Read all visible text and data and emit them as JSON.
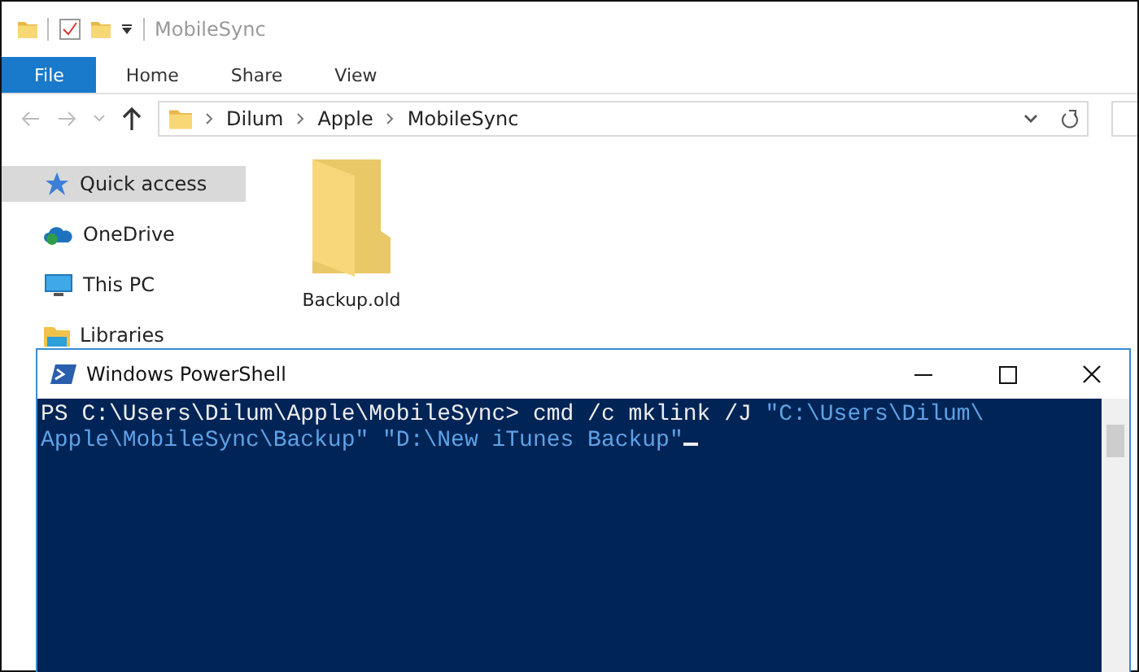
{
  "explorer": {
    "title": "MobileSync",
    "tabs": [
      {
        "label": "File",
        "selected": true
      },
      {
        "label": "Home",
        "selected": false
      },
      {
        "label": "Share",
        "selected": false
      },
      {
        "label": "View",
        "selected": false
      }
    ],
    "breadcrumbs": [
      "Dilum",
      "Apple",
      "MobileSync"
    ],
    "sidebar": [
      {
        "label": "Quick access",
        "kind": "star",
        "selected": true
      },
      {
        "label": "OneDrive",
        "kind": "cloud",
        "selected": false
      },
      {
        "label": "This PC",
        "kind": "pc",
        "selected": false
      },
      {
        "label": "Libraries",
        "kind": "library",
        "selected": false
      }
    ],
    "items": [
      {
        "name": "Backup.old"
      }
    ]
  },
  "powershell": {
    "title": "Windows PowerShell",
    "lines": [
      [
        {
          "kind": "plain",
          "text": "PS C:\\Users\\Dilum\\Apple\\MobileSync> cmd /c mklink /J "
        },
        {
          "kind": "string",
          "text": "\"C:\\Users\\Dilum\\"
        }
      ],
      [
        {
          "kind": "string",
          "text": "Apple\\MobileSync\\Backup\" \"D:\\New iTunes Backup\""
        }
      ]
    ]
  }
}
